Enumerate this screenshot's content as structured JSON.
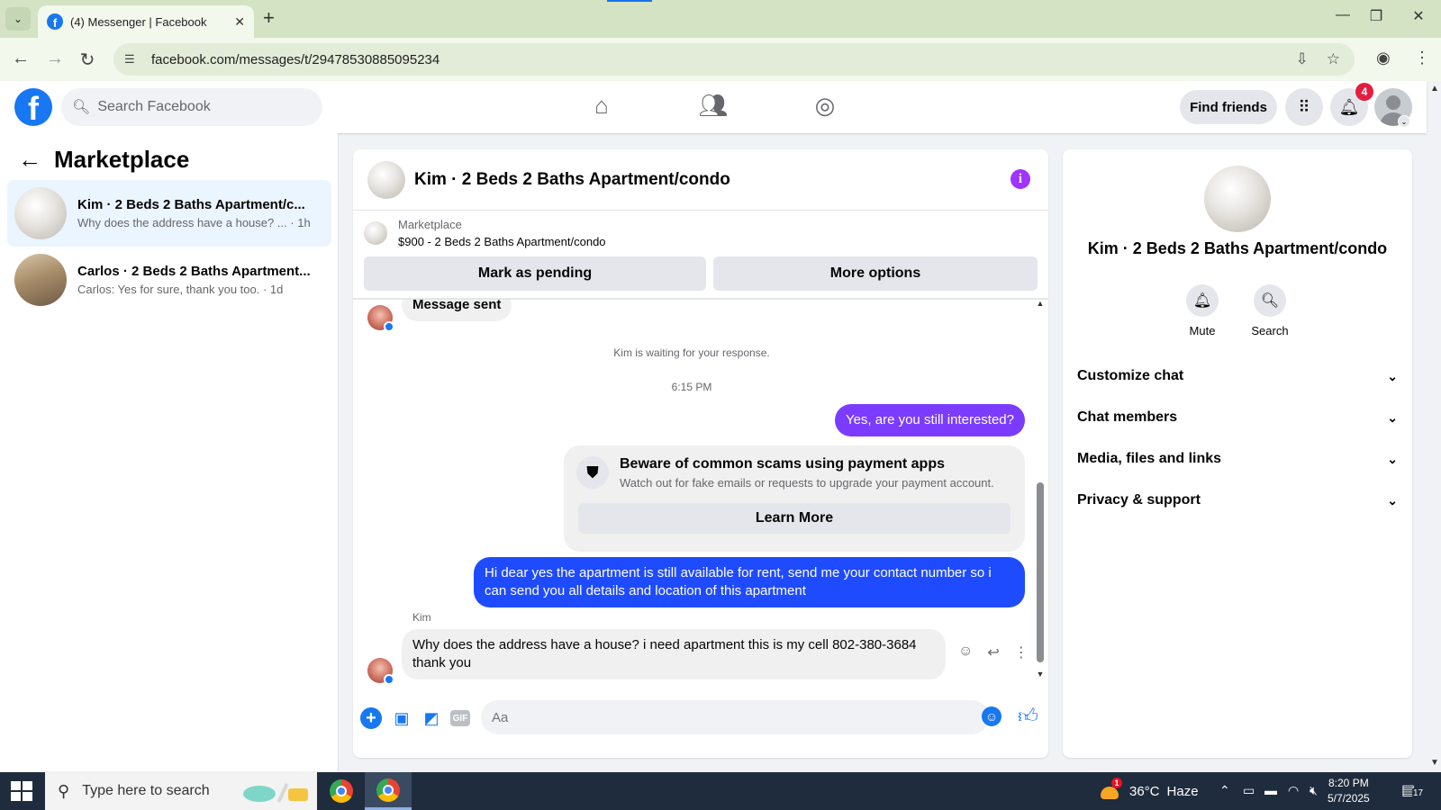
{
  "browser": {
    "tab_title": "(4) Messenger | Facebook",
    "tab_close": "✕",
    "new_tab": "+",
    "url": "facebook.com/messages/t/29478530885095234",
    "window_controls": [
      "—",
      "❐",
      "✕"
    ]
  },
  "fb_header": {
    "logo": "f",
    "search_placeholder": "Search Facebook",
    "find_friends_label": "Find friends",
    "notification_count": "4",
    "icons": [
      "home-icon",
      "friends-icon",
      "groups-icon",
      "menu-grid-icon",
      "bell-icon",
      "profile-avatar"
    ]
  },
  "left_panel": {
    "title": "Marketplace",
    "conversations": [
      {
        "name": "Kim · 2 Beds 2 Baths Apartment/c...",
        "snippet": "Why does the address have a house? ... · 1h",
        "active": true
      },
      {
        "name": "Carlos · 2 Beds 2 Baths Apartment...",
        "snippet": "Carlos: Yes for sure, thank you too. · 1d",
        "active": false
      }
    ]
  },
  "chat": {
    "title": "Kim · 2 Beds 2 Baths Apartment/condo",
    "listing_source": "Marketplace",
    "listing_price_title": "$900 - 2 Beds 2 Baths Apartment/condo",
    "mark_pending_label": "Mark as pending",
    "more_options_label": "More options",
    "messages": {
      "message_sent": "Message sent",
      "waiting_notice": "Kim is waiting for your response.",
      "timestamp": "6:15 PM",
      "out_1": "Yes, are you still interested?",
      "out_2": "Hi dear yes the apartment is still available for rent, send me your contact number so i can send you all details and location of this apartment",
      "sender_name": "Kim",
      "in_1": "Why does the address have a house? i need apartment this is my cell 802-380-3684 thank you"
    },
    "scam_warning": {
      "title": "Beware of common scams using payment apps",
      "subtitle": "Watch out for fake emails or requests to upgrade your payment account.",
      "button_label": "Learn More"
    },
    "composer_placeholder": "Aa",
    "composer_gif_label": "GIF"
  },
  "right_panel": {
    "name": "Kim · 2 Beds 2 Baths Apartment/condo",
    "actions": [
      {
        "label": "Mute",
        "icon": "bell-icon"
      },
      {
        "label": "Search",
        "icon": "search-icon"
      }
    ],
    "sections": [
      "Customize chat",
      "Chat members",
      "Media, files and links",
      "Privacy & support"
    ]
  },
  "taskbar": {
    "search_placeholder": "Type here to search",
    "weather_temp": "36°C",
    "weather_desc": "Haze",
    "weather_badge": "1",
    "time": "8:20 PM",
    "date": "5/7/2025",
    "notification_count": "17"
  },
  "colors": {
    "facebook_blue": "#1877f2",
    "outgoing_purple": "#7b3cff",
    "outgoing_blue": "#1f4bff",
    "info_purple": "#a033ff",
    "badge_red": "#e41e3f",
    "browser_frame": "#d3e3c4"
  }
}
